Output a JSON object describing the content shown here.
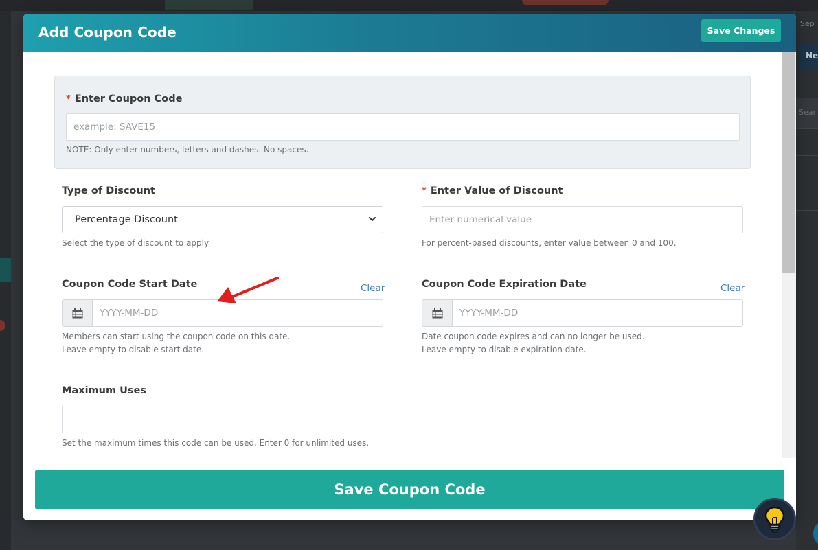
{
  "background": {
    "right_panel": {
      "top_text": "Sep",
      "button_text": "Ne",
      "search_text": "Sear"
    }
  },
  "modal": {
    "title": "Add Coupon Code",
    "header_save_label": "Save Changes",
    "coupon_code": {
      "required_mark": "*",
      "label": "Enter Coupon Code",
      "placeholder": "example: SAVE15",
      "value": "",
      "note": "NOTE: Only enter numbers, letters and dashes. No spaces."
    },
    "discount_type": {
      "label": "Type of Discount",
      "selected": "Percentage Discount",
      "help": "Select the type of discount to apply"
    },
    "discount_value": {
      "required_mark": "*",
      "label": "Enter Value of Discount",
      "placeholder": "Enter numerical value",
      "value": "",
      "help": "For percent-based discounts, enter value between 0 and 100."
    },
    "start_date": {
      "label": "Coupon Code Start Date",
      "clear_label": "Clear",
      "placeholder": "YYYY-MM-DD",
      "value": "",
      "help_line1": "Members can start using the coupon code on this date.",
      "help_line2": "Leave empty to disable start date."
    },
    "expiration_date": {
      "label": "Coupon Code Expiration Date",
      "clear_label": "Clear",
      "placeholder": "YYYY-MM-DD",
      "value": "",
      "help_line1": "Date coupon code expires and can no longer be used.",
      "help_line2": "Leave empty to disable expiration date."
    },
    "max_uses": {
      "label": "Maximum Uses",
      "value": "",
      "help": "Set the maximum times this code can be used. Enter 0 for unlimited uses."
    },
    "footer_save_label": "Save Coupon Code"
  },
  "icons": {
    "calendar": "calendar-icon",
    "chevron": "chevron-down-icon",
    "annotation": "red-arrow-annotation",
    "help": "lightbulb-icon"
  },
  "colors": {
    "primary_button": "#1fa99a",
    "header_gradient_start": "#1ea0ae",
    "header_gradient_end": "#1a5f7f",
    "required": "#d9413b",
    "link": "#3b7bb8",
    "annotation_arrow": "#e0201c"
  }
}
